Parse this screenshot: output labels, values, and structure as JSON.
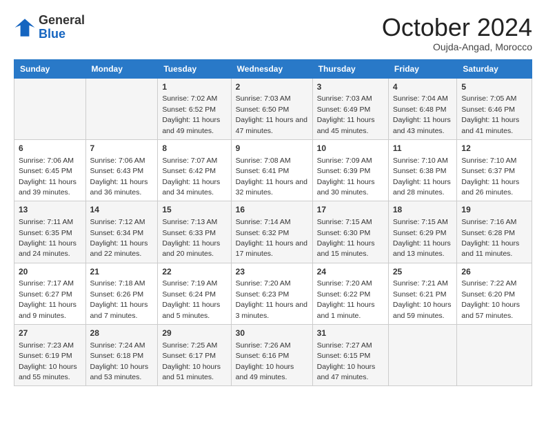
{
  "logo": {
    "line1": "General",
    "line2": "Blue"
  },
  "title": "October 2024",
  "subtitle": "Oujda-Angad, Morocco",
  "days_header": [
    "Sunday",
    "Monday",
    "Tuesday",
    "Wednesday",
    "Thursday",
    "Friday",
    "Saturday"
  ],
  "weeks": [
    [
      {
        "day": "",
        "info": ""
      },
      {
        "day": "",
        "info": ""
      },
      {
        "day": "1",
        "info": "Sunrise: 7:02 AM\nSunset: 6:52 PM\nDaylight: 11 hours and 49 minutes."
      },
      {
        "day": "2",
        "info": "Sunrise: 7:03 AM\nSunset: 6:50 PM\nDaylight: 11 hours and 47 minutes."
      },
      {
        "day": "3",
        "info": "Sunrise: 7:03 AM\nSunset: 6:49 PM\nDaylight: 11 hours and 45 minutes."
      },
      {
        "day": "4",
        "info": "Sunrise: 7:04 AM\nSunset: 6:48 PM\nDaylight: 11 hours and 43 minutes."
      },
      {
        "day": "5",
        "info": "Sunrise: 7:05 AM\nSunset: 6:46 PM\nDaylight: 11 hours and 41 minutes."
      }
    ],
    [
      {
        "day": "6",
        "info": "Sunrise: 7:06 AM\nSunset: 6:45 PM\nDaylight: 11 hours and 39 minutes."
      },
      {
        "day": "7",
        "info": "Sunrise: 7:06 AM\nSunset: 6:43 PM\nDaylight: 11 hours and 36 minutes."
      },
      {
        "day": "8",
        "info": "Sunrise: 7:07 AM\nSunset: 6:42 PM\nDaylight: 11 hours and 34 minutes."
      },
      {
        "day": "9",
        "info": "Sunrise: 7:08 AM\nSunset: 6:41 PM\nDaylight: 11 hours and 32 minutes."
      },
      {
        "day": "10",
        "info": "Sunrise: 7:09 AM\nSunset: 6:39 PM\nDaylight: 11 hours and 30 minutes."
      },
      {
        "day": "11",
        "info": "Sunrise: 7:10 AM\nSunset: 6:38 PM\nDaylight: 11 hours and 28 minutes."
      },
      {
        "day": "12",
        "info": "Sunrise: 7:10 AM\nSunset: 6:37 PM\nDaylight: 11 hours and 26 minutes."
      }
    ],
    [
      {
        "day": "13",
        "info": "Sunrise: 7:11 AM\nSunset: 6:35 PM\nDaylight: 11 hours and 24 minutes."
      },
      {
        "day": "14",
        "info": "Sunrise: 7:12 AM\nSunset: 6:34 PM\nDaylight: 11 hours and 22 minutes."
      },
      {
        "day": "15",
        "info": "Sunrise: 7:13 AM\nSunset: 6:33 PM\nDaylight: 11 hours and 20 minutes."
      },
      {
        "day": "16",
        "info": "Sunrise: 7:14 AM\nSunset: 6:32 PM\nDaylight: 11 hours and 17 minutes."
      },
      {
        "day": "17",
        "info": "Sunrise: 7:15 AM\nSunset: 6:30 PM\nDaylight: 11 hours and 15 minutes."
      },
      {
        "day": "18",
        "info": "Sunrise: 7:15 AM\nSunset: 6:29 PM\nDaylight: 11 hours and 13 minutes."
      },
      {
        "day": "19",
        "info": "Sunrise: 7:16 AM\nSunset: 6:28 PM\nDaylight: 11 hours and 11 minutes."
      }
    ],
    [
      {
        "day": "20",
        "info": "Sunrise: 7:17 AM\nSunset: 6:27 PM\nDaylight: 11 hours and 9 minutes."
      },
      {
        "day": "21",
        "info": "Sunrise: 7:18 AM\nSunset: 6:26 PM\nDaylight: 11 hours and 7 minutes."
      },
      {
        "day": "22",
        "info": "Sunrise: 7:19 AM\nSunset: 6:24 PM\nDaylight: 11 hours and 5 minutes."
      },
      {
        "day": "23",
        "info": "Sunrise: 7:20 AM\nSunset: 6:23 PM\nDaylight: 11 hours and 3 minutes."
      },
      {
        "day": "24",
        "info": "Sunrise: 7:20 AM\nSunset: 6:22 PM\nDaylight: 11 hours and 1 minute."
      },
      {
        "day": "25",
        "info": "Sunrise: 7:21 AM\nSunset: 6:21 PM\nDaylight: 10 hours and 59 minutes."
      },
      {
        "day": "26",
        "info": "Sunrise: 7:22 AM\nSunset: 6:20 PM\nDaylight: 10 hours and 57 minutes."
      }
    ],
    [
      {
        "day": "27",
        "info": "Sunrise: 7:23 AM\nSunset: 6:19 PM\nDaylight: 10 hours and 55 minutes."
      },
      {
        "day": "28",
        "info": "Sunrise: 7:24 AM\nSunset: 6:18 PM\nDaylight: 10 hours and 53 minutes."
      },
      {
        "day": "29",
        "info": "Sunrise: 7:25 AM\nSunset: 6:17 PM\nDaylight: 10 hours and 51 minutes."
      },
      {
        "day": "30",
        "info": "Sunrise: 7:26 AM\nSunset: 6:16 PM\nDaylight: 10 hours and 49 minutes."
      },
      {
        "day": "31",
        "info": "Sunrise: 7:27 AM\nSunset: 6:15 PM\nDaylight: 10 hours and 47 minutes."
      },
      {
        "day": "",
        "info": ""
      },
      {
        "day": "",
        "info": ""
      }
    ]
  ]
}
